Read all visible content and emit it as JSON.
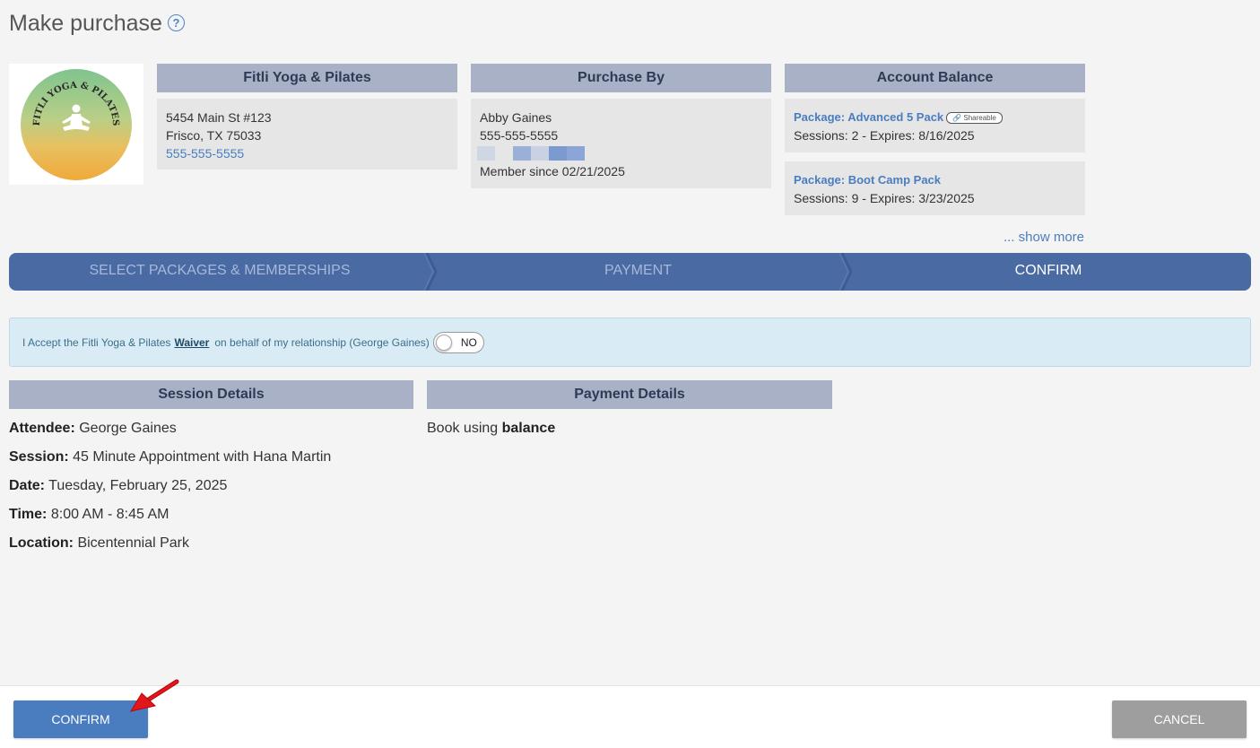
{
  "page": {
    "title": "Make purchase"
  },
  "business": {
    "header": "Fitli Yoga & Pilates",
    "address1": "5454 Main St #123",
    "address2": "Frisco, TX 75033",
    "phone": "555-555-5555",
    "logo_text": "FITLI YOGA & PILATES"
  },
  "purchaser": {
    "header": "Purchase By",
    "name": "Abby Gaines",
    "phone": "555-555-5555",
    "member_since": "Member since 02/21/2025"
  },
  "account_balance": {
    "header": "Account Balance",
    "packages": [
      {
        "name": "Package: Advanced 5 Pack",
        "badge": "Shareable",
        "sessions": "Sessions: 2 -",
        "expires": "Expires: 8/16/2025"
      },
      {
        "name": "Package: Boot Camp Pack",
        "sessions": "Sessions: 9 -",
        "expires": "Expires: 3/23/2025"
      }
    ],
    "show_more": "... show more"
  },
  "steps": [
    {
      "label": "SELECT PACKAGES & MEMBERSHIPS"
    },
    {
      "label": "PAYMENT"
    },
    {
      "label": "CONFIRM"
    }
  ],
  "waiver": {
    "prefix": "I Accept the Fitli Yoga & Pilates",
    "link": "Waiver",
    "suffix": "on behalf of my relationship (George Gaines)",
    "toggle": "NO"
  },
  "session_details": {
    "header": "Session Details",
    "attendee_label": "Attendee:",
    "attendee": "George Gaines",
    "session_label": "Session:",
    "session": "45 Minute Appointment with Hana Martin",
    "date_label": "Date:",
    "date": "Tuesday, February 25, 2025",
    "time_label": "Time:",
    "time": "8:00 AM - 8:45 AM",
    "location_label": "Location:",
    "location": "Bicentennial Park"
  },
  "payment_details": {
    "header": "Payment Details",
    "prefix": "Book using",
    "method": "balance"
  },
  "footer": {
    "confirm": "CONFIRM",
    "cancel": "CANCEL"
  },
  "colors": {
    "accent": "#4a7dbf",
    "stepper": "#4a6aa3",
    "header_band": "#a9b1c7",
    "cancel": "#9e9e9e",
    "arrow": "#e3161b"
  }
}
